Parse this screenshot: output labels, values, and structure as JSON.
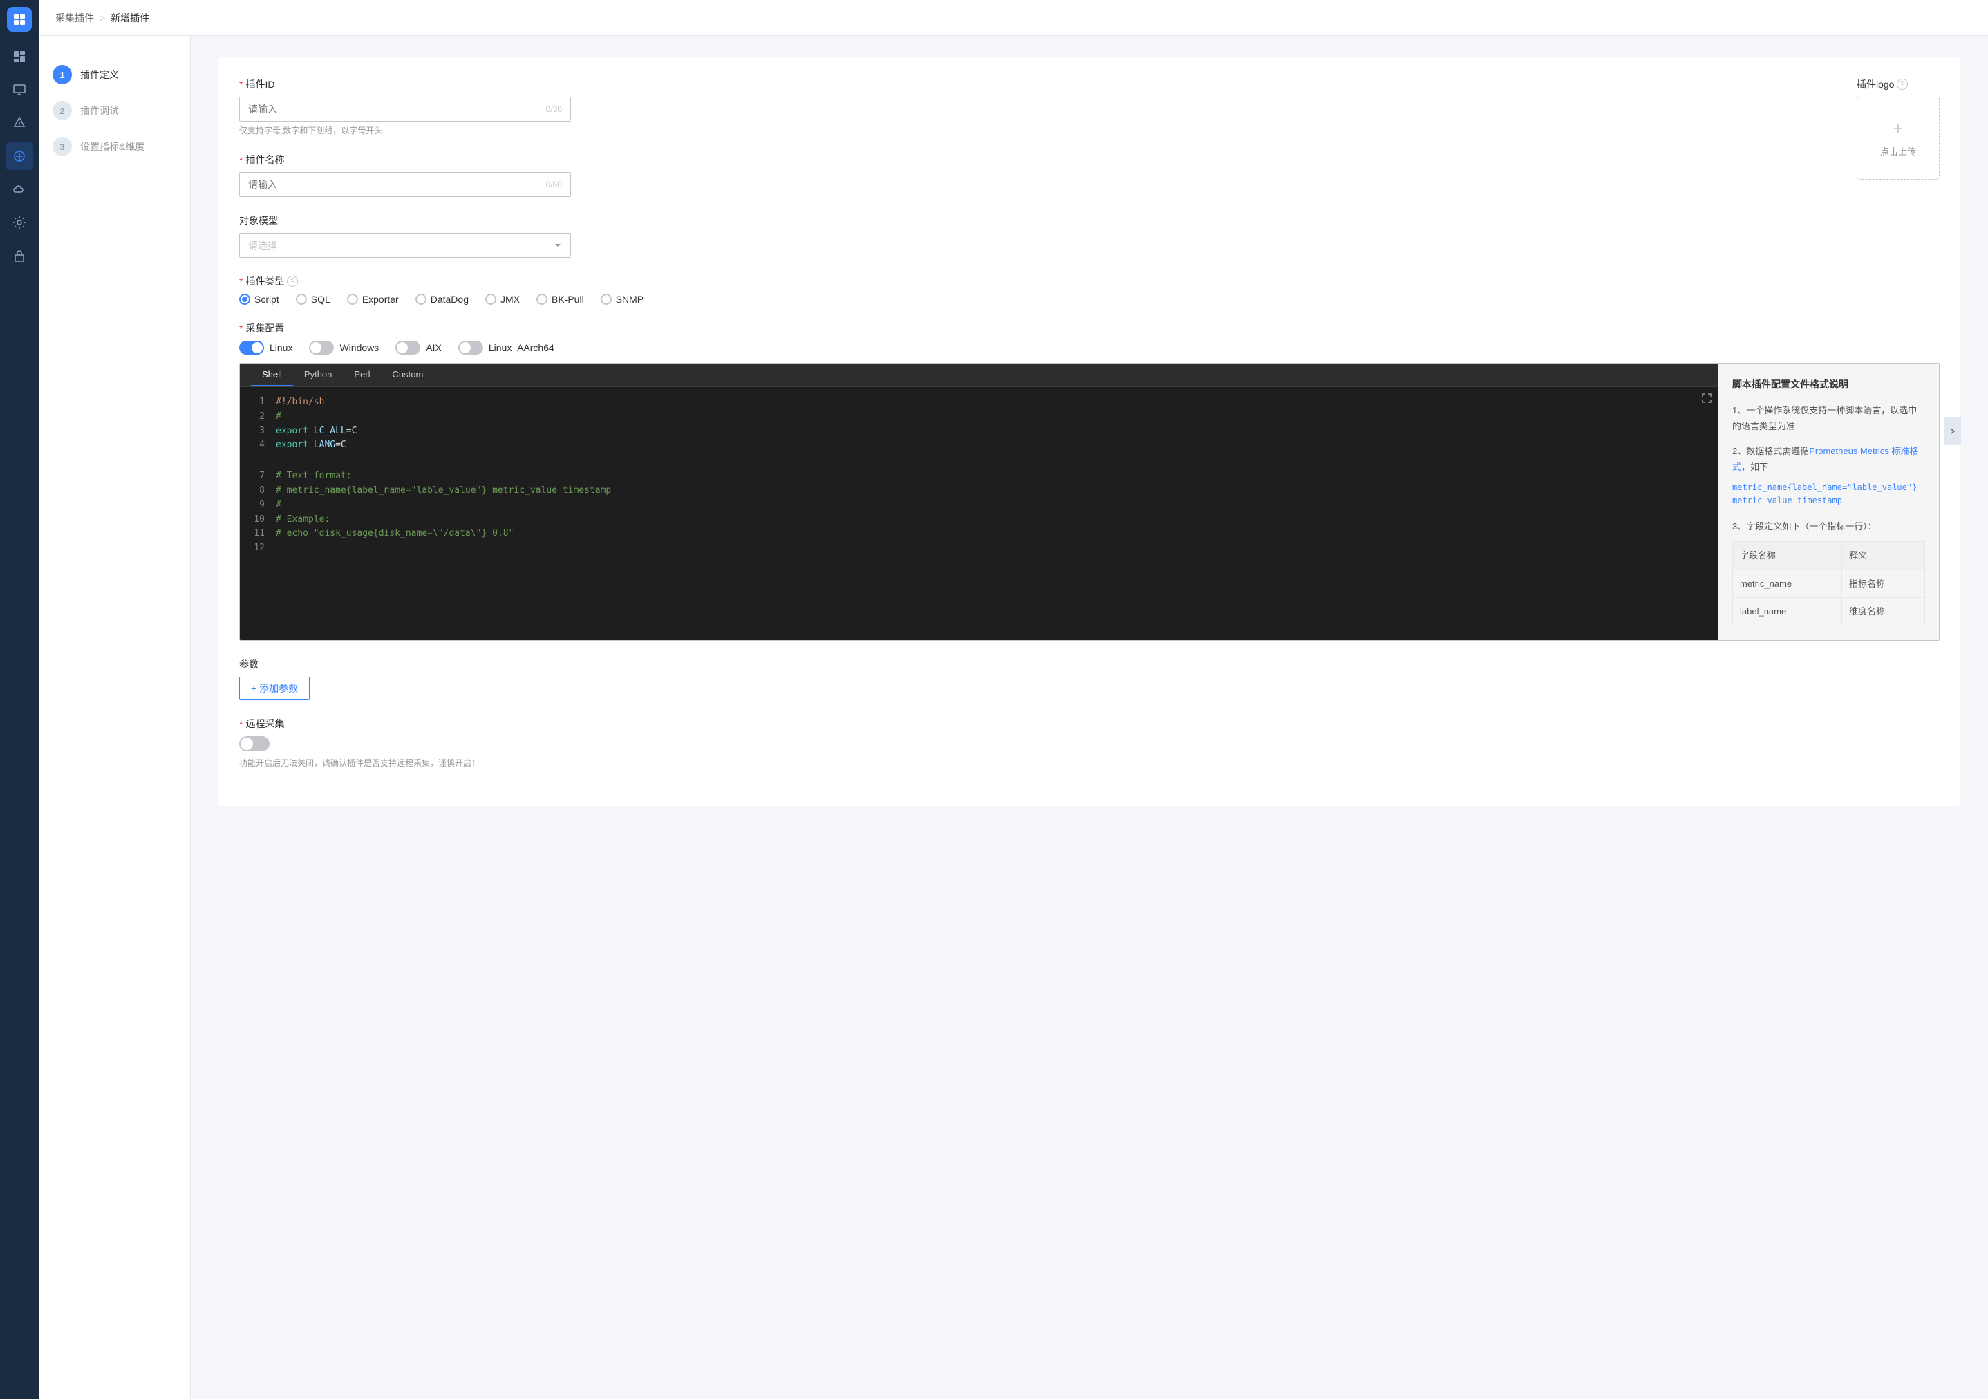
{
  "sidebar": {
    "logo": "grid-icon",
    "items": [
      {
        "id": "dashboard",
        "icon": "dashboard-icon",
        "active": false
      },
      {
        "id": "monitor",
        "icon": "monitor-icon",
        "active": false
      },
      {
        "id": "alert",
        "icon": "alert-icon",
        "active": false
      },
      {
        "id": "collect",
        "icon": "collect-icon",
        "active": true
      },
      {
        "id": "cloud",
        "icon": "cloud-icon",
        "active": false
      },
      {
        "id": "tools",
        "icon": "tools-icon",
        "active": false
      },
      {
        "id": "lock",
        "icon": "lock-icon",
        "active": false
      }
    ]
  },
  "header": {
    "breadcrumb_parent": "采集插件",
    "breadcrumb_sep": ">",
    "breadcrumb_current": "新增插件"
  },
  "steps": [
    {
      "number": "1",
      "label": "插件定义",
      "active": true
    },
    {
      "number": "2",
      "label": "插件调试",
      "active": false
    },
    {
      "number": "3",
      "label": "设置指标&维度",
      "active": false
    }
  ],
  "form": {
    "plugin_id_label": "插件ID",
    "plugin_id_required": true,
    "plugin_id_placeholder": "请输入",
    "plugin_id_count": "0/30",
    "plugin_id_hint": "仅支持字母,数字和下划线，以字母开头",
    "plugin_name_label": "插件名称",
    "plugin_name_required": true,
    "plugin_name_placeholder": "请输入",
    "plugin_name_count": "0/50",
    "object_model_label": "对象模型",
    "object_model_placeholder": "请选择",
    "plugin_type_label": "插件类型",
    "plugin_type_question": true,
    "plugin_types": [
      {
        "label": "Script",
        "checked": true
      },
      {
        "label": "SQL",
        "checked": false
      },
      {
        "label": "Exporter",
        "checked": false
      },
      {
        "label": "DataDog",
        "checked": false
      },
      {
        "label": "JMX",
        "checked": false
      },
      {
        "label": "BK-Pull",
        "checked": false
      },
      {
        "label": "SNMP",
        "checked": false
      }
    ],
    "collect_config_label": "采集配置",
    "collect_config_required": true,
    "os_tabs": [
      {
        "label": "Linux",
        "active": true,
        "on": true
      },
      {
        "label": "Windows",
        "active": false,
        "on": false
      },
      {
        "label": "AIX",
        "active": false,
        "on": false
      },
      {
        "label": "Linux_AArch64",
        "active": false,
        "on": false
      }
    ],
    "code_tabs": [
      {
        "label": "Shell",
        "active": true
      },
      {
        "label": "Python",
        "active": false
      },
      {
        "label": "Perl",
        "active": false
      },
      {
        "label": "Custom",
        "active": false
      }
    ],
    "code_lines": [
      {
        "num": 1,
        "code": "#!/bin/sh",
        "type": "shebang"
      },
      {
        "num": 2,
        "code": "#",
        "type": "comment"
      },
      {
        "num": 3,
        "code": "export LC_ALL=C",
        "type": "code"
      },
      {
        "num": 4,
        "code": "export LANG=C",
        "type": "code"
      },
      {
        "num": 7,
        "code": "# Text format:",
        "type": "comment"
      },
      {
        "num": 8,
        "code": "# metric_name{label_name=\"lable_value\"} metric_value timestamp",
        "type": "comment"
      },
      {
        "num": 9,
        "code": "#",
        "type": "comment"
      },
      {
        "num": 10,
        "code": "# Example:",
        "type": "comment"
      },
      {
        "num": 11,
        "code": "# echo \"disk_usage{disk_name=\\\"/data\\\"} 0.8\"",
        "type": "comment"
      },
      {
        "num": 12,
        "code": "",
        "type": "empty"
      }
    ],
    "params_label": "参数",
    "add_param_label": "+ 添加参数",
    "remote_collect_label": "远程采集",
    "remote_collect_required": true,
    "remote_collect_hint": "功能开启后无法关闭，请确认插件是否支持远程采集，谨慎开启！"
  },
  "help": {
    "title": "脚本插件配置文件格式说明",
    "point1": "1、一个操作系统仅支持一种脚本语言，以选中的语言类型为准",
    "point2_prefix": "2、数据格式需遵循",
    "point2_link": "Prometheus Metrics 标准格式",
    "point2_suffix": "，如下",
    "point2_example": "metric_name{label_name=\"lable_value\"} metric_value timestamp",
    "point3": "3、字段定义如下（一个指标一行）：",
    "table_headers": [
      "字段名称",
      "释义"
    ],
    "table_rows": [
      [
        "metric_name",
        "指标名称"
      ],
      [
        "label_name",
        "维度名称"
      ]
    ]
  },
  "logo": {
    "label": "插件logo",
    "upload_label": "点击上传"
  }
}
